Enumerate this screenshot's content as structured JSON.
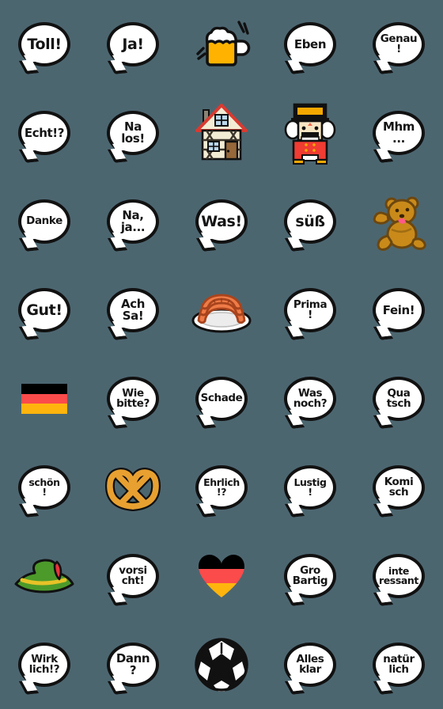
{
  "sheet": {
    "title": "German Expressions Emoji Sheet",
    "background_color": "#4c6670",
    "columns": 5,
    "rows": 8,
    "bubble_fill": "#ffffff",
    "bubble_outline": "#111111",
    "flag_colors": {
      "black": "#000000",
      "red": "#fb4b4b",
      "gold": "#ffb40d"
    },
    "accent_colors": {
      "beer": "#ffb300",
      "pretzel": "#e8a030",
      "bear": "#c98a1a",
      "sausage": "#ef7b47",
      "hat_green": "#4c9a2a",
      "hat_band": "#e7c227",
      "hat_feather": "#e8353b",
      "house_wall": "#f5efd8",
      "house_roof": "#d93a30",
      "nutcracker_coat": "#f03c32"
    }
  },
  "cells": [
    {
      "id": "toll",
      "kind": "bubble",
      "text": "Toll!",
      "size": "t1"
    },
    {
      "id": "ja",
      "kind": "bubble",
      "text": "Ja!",
      "size": "t1"
    },
    {
      "id": "beer",
      "kind": "art",
      "icon": "beer-mug-icon",
      "text": ""
    },
    {
      "id": "eben",
      "kind": "bubble",
      "text": "Eben",
      "size": "t2"
    },
    {
      "id": "genau",
      "kind": "bubble",
      "text": "Genau\n!",
      "size": "t3"
    },
    {
      "id": "echt",
      "kind": "bubble",
      "text": "Echt!?",
      "size": "t2"
    },
    {
      "id": "nalos",
      "kind": "bubble",
      "text": "Na\nlos!",
      "size": "t2"
    },
    {
      "id": "house",
      "kind": "art",
      "icon": "half-timbered-house-icon",
      "text": ""
    },
    {
      "id": "nutcracker",
      "kind": "art",
      "icon": "nutcracker-icon",
      "text": ""
    },
    {
      "id": "mhm",
      "kind": "bubble",
      "text": "Mhm\n...",
      "size": "t2"
    },
    {
      "id": "danke",
      "kind": "bubble",
      "text": "Danke",
      "size": "t3"
    },
    {
      "id": "naja",
      "kind": "bubble",
      "text": "Na,\nja...",
      "size": "t2"
    },
    {
      "id": "was",
      "kind": "bubble",
      "text": "Was!",
      "size": "t1"
    },
    {
      "id": "suess",
      "kind": "bubble",
      "text": "süß",
      "size": "t1"
    },
    {
      "id": "teddy",
      "kind": "art",
      "icon": "teddy-bear-icon",
      "text": ""
    },
    {
      "id": "gut",
      "kind": "bubble",
      "text": "Gut!",
      "size": "t1"
    },
    {
      "id": "achsa",
      "kind": "bubble",
      "text": "Ach\nSa!",
      "size": "t2"
    },
    {
      "id": "sausages",
      "kind": "art",
      "icon": "bratwurst-plate-icon",
      "text": ""
    },
    {
      "id": "prima",
      "kind": "bubble",
      "text": "Prima\n!",
      "size": "t3"
    },
    {
      "id": "fein",
      "kind": "bubble",
      "text": "Fein!",
      "size": "t2"
    },
    {
      "id": "flag",
      "kind": "flag",
      "icon": "german-flag-icon",
      "text": ""
    },
    {
      "id": "wiebitte",
      "kind": "bubble",
      "text": "Wie\nbitte?",
      "size": "t3"
    },
    {
      "id": "schade",
      "kind": "bubble",
      "text": "Schade",
      "size": "t3"
    },
    {
      "id": "wasnoch",
      "kind": "bubble",
      "text": "Was\nnoch?",
      "size": "t3"
    },
    {
      "id": "quatsch",
      "kind": "bubble",
      "text": "Qua\ntsch",
      "size": "t3"
    },
    {
      "id": "schoen",
      "kind": "bubble",
      "text": "schön\n!",
      "size": "t4"
    },
    {
      "id": "pretzel",
      "kind": "art",
      "icon": "pretzel-icon",
      "text": ""
    },
    {
      "id": "ehrlich",
      "kind": "bubble",
      "text": "Ehrlich\n!?",
      "size": "t4"
    },
    {
      "id": "lustig",
      "kind": "bubble",
      "text": "Lustig\n!",
      "size": "t4"
    },
    {
      "id": "komisch",
      "kind": "bubble",
      "text": "Komi\nsch",
      "size": "t3"
    },
    {
      "id": "hat",
      "kind": "art",
      "icon": "tyrolean-hat-icon",
      "text": ""
    },
    {
      "id": "vorsicht",
      "kind": "bubble",
      "text": "vorsi\ncht!",
      "size": "t3"
    },
    {
      "id": "heartflag",
      "kind": "heart",
      "icon": "german-flag-heart-icon",
      "text": ""
    },
    {
      "id": "grossartig",
      "kind": "bubble",
      "text": "Gro\nBartig",
      "size": "t3"
    },
    {
      "id": "interessant",
      "kind": "bubble",
      "text": "inte\nressant",
      "size": "t4"
    },
    {
      "id": "wirklich",
      "kind": "bubble",
      "text": "Wirk\nlich!?",
      "size": "t3"
    },
    {
      "id": "dann",
      "kind": "bubble",
      "text": "Dann\n?",
      "size": "t2"
    },
    {
      "id": "soccer",
      "kind": "art",
      "icon": "soccer-ball-icon",
      "text": ""
    },
    {
      "id": "allesklar",
      "kind": "bubble",
      "text": "Alles\nklar",
      "size": "t3"
    },
    {
      "id": "natuerlich",
      "kind": "bubble",
      "text": "natür\nlich",
      "size": "t3"
    }
  ]
}
